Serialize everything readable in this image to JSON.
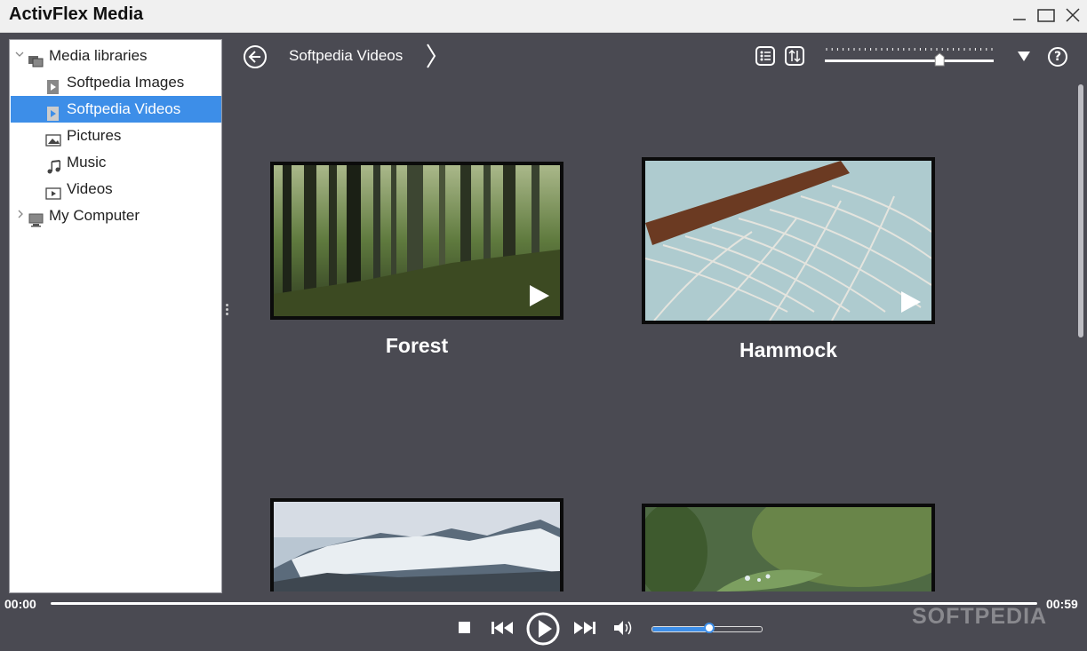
{
  "window": {
    "title": "ActivFlex Media",
    "controls": [
      "minimize-icon",
      "maximize-icon",
      "close-icon"
    ]
  },
  "sidebar": {
    "items": [
      {
        "label": "Media libraries",
        "icon": "media-library-icon",
        "expanded": true
      },
      {
        "label": "Softpedia Images",
        "icon": "library-icon"
      },
      {
        "label": "Softpedia Videos",
        "icon": "library-icon",
        "selected": true
      },
      {
        "label": "Pictures",
        "icon": "picture-icon"
      },
      {
        "label": "Music",
        "icon": "music-icon"
      },
      {
        "label": "Videos",
        "icon": "video-icon"
      },
      {
        "label": "My Computer",
        "icon": "computer-icon",
        "expanded": false
      }
    ]
  },
  "toolbar": {
    "breadcrumb": "Softpedia Videos",
    "icons": [
      "back-icon",
      "list-view-icon",
      "sort-icon",
      "dropdown-icon",
      "help-icon"
    ],
    "zoom_level": 0.68
  },
  "grid": {
    "items": [
      {
        "title": "Forest",
        "thumbnail": "forest-thumbnail"
      },
      {
        "title": "Hammock",
        "thumbnail": "hammock-thumbnail"
      },
      {
        "title": "",
        "thumbnail": "mountains-thumbnail"
      },
      {
        "title": "",
        "thumbnail": "leaf-thumbnail"
      }
    ]
  },
  "player": {
    "time_current": "00:00",
    "time_total": "00:59",
    "progress": 0.0,
    "volume": 0.52
  },
  "watermark": "SOFTPEDIA",
  "colors": {
    "accent": "#3d8ee8",
    "background": "#4a4a52",
    "titlebar": "#f0f0f0"
  }
}
